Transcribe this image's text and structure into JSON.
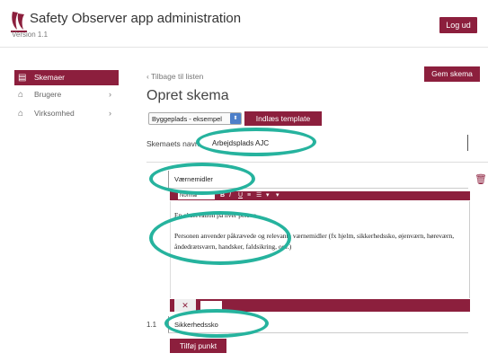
{
  "header": {
    "app_title": "Safety Observer app administration",
    "version": "Version 1.1",
    "logout_label": "Log ud"
  },
  "sidebar": {
    "items": [
      {
        "label": "Skemaer",
        "icon": "document-icon",
        "active": true
      },
      {
        "label": "Brugere",
        "icon": "home-icon",
        "active": false
      },
      {
        "label": "Virksomhed",
        "icon": "home-icon",
        "active": false
      }
    ]
  },
  "main": {
    "back_link": "‹ Tilbage til listen",
    "save_label": "Gem skema",
    "title": "Opret skema",
    "template_select_value": "Byggeplads - eksempel",
    "load_template_label": "Indlæs template",
    "name_label": "Skemaets navn",
    "name_value": "Arbejdsplads AJC"
  },
  "section": {
    "title": "Værnemidler",
    "toolbar_format": "Normal",
    "paragraphs": [
      "En observation på hver person",
      "Personen anvender påkrævede og relevante værnemidler (fx hjelm, sikkerhedssko, øjenværn, høreværn, åndedrætsværn, handsker, faldsikring, osv.)"
    ],
    "item_number": "1.1",
    "item_value": "Sikkerhedssko",
    "add_point_label": "Tilføj punkt"
  },
  "colors": {
    "accent": "#8c1f3d",
    "annotation": "#26b39e"
  }
}
